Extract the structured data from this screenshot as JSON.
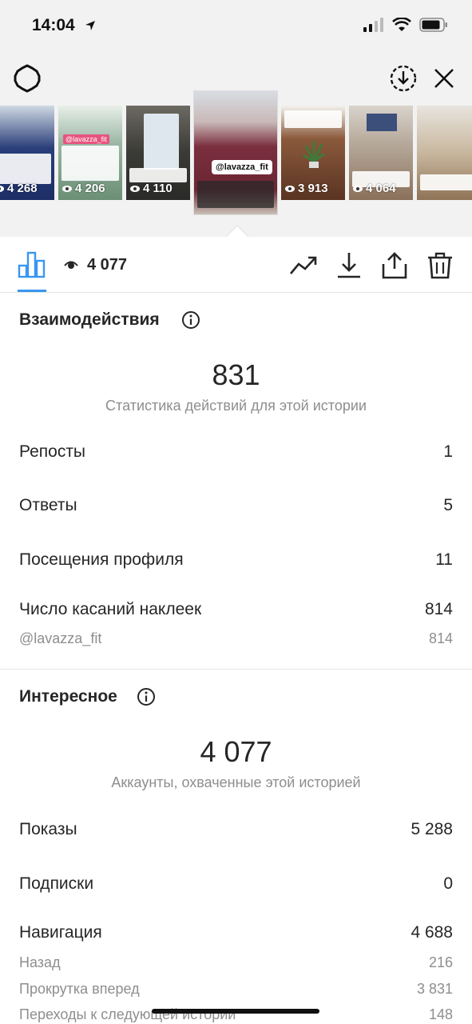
{
  "status_bar": {
    "time": "14:04"
  },
  "thumbnails": [
    {
      "views": "4 268"
    },
    {
      "views": "4 206",
      "tag": "@lavazza_fit"
    },
    {
      "views": "4 110"
    },
    {
      "views": "",
      "label": "@lavazza_fit"
    },
    {
      "views": "3 913"
    },
    {
      "views": "4 064"
    },
    {
      "views": ""
    }
  ],
  "action_bar": {
    "view_count": "4 077"
  },
  "interactions": {
    "title": "Взаимодействия",
    "total": "831",
    "subtitle": "Статистика действий для этой истории",
    "rows": [
      {
        "label": "Репосты",
        "value": "1"
      },
      {
        "label": "Ответы",
        "value": "5"
      },
      {
        "label": "Посещения профиля",
        "value": "11"
      },
      {
        "label": "Число касаний наклеек",
        "value": "814"
      }
    ],
    "sub_rows": [
      {
        "label": "@lavazza_fit",
        "value": "814"
      }
    ]
  },
  "discovery": {
    "title": "Интересное",
    "total": "4 077",
    "subtitle": "Аккаунты, охваченные этой историей",
    "rows": [
      {
        "label": "Показы",
        "value": "5 288"
      },
      {
        "label": "Подписки",
        "value": "0"
      },
      {
        "label": "Навигация",
        "value": "4 688"
      }
    ],
    "sub_rows": [
      {
        "label": "Назад",
        "value": "216"
      },
      {
        "label": "Прокрутка вперед",
        "value": "3 831"
      },
      {
        "label": "Переходы к следующей истории",
        "value": "148"
      }
    ]
  },
  "colors": {
    "accent": "#3897f0",
    "text": "#262626",
    "muted": "#8e8e8e",
    "header_bg": "#f2f2f2"
  }
}
